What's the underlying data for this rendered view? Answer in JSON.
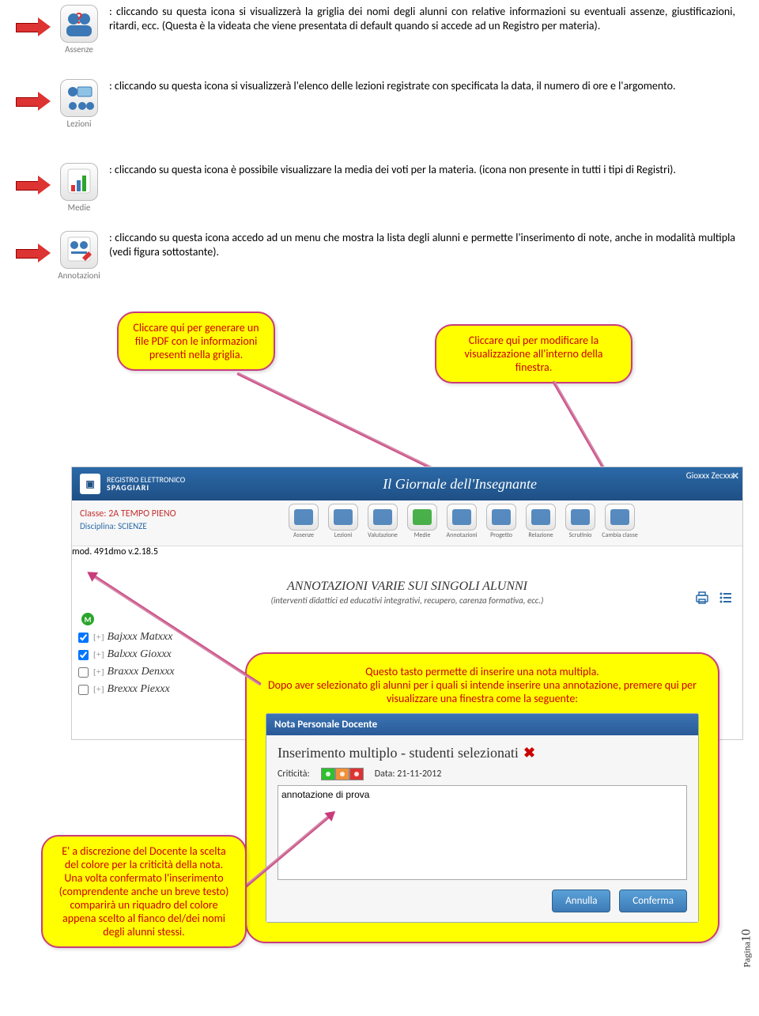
{
  "icons": {
    "assenze": {
      "label": "Assenze",
      "desc": ": cliccando su questa icona si visualizzerà la griglia dei nomi degli alunni con relative informazioni su eventuali assenze, giustificazioni, ritardi, ecc. (Questa è la videata che viene presentata di default quando si accede ad un Registro per materia)."
    },
    "lezioni": {
      "label": "Lezioni",
      "desc": ": cliccando su questa icona si visualizzerà l'elenco delle lezioni registrate con specificata la data, il numero di ore e l'argomento."
    },
    "medie": {
      "label": "Medie",
      "desc": ": cliccando su questa icona è possibile visualizzare la media dei voti per la materia. (icona non presente in tutti i tipi di Registri)."
    },
    "annotaz": {
      "label": "Annotazioni",
      "desc": ": cliccando su questa icona accedo ad un menu che mostra la lista degli alunni e permette l'inserimento di note, anche in modalità multipla (vedi figura sottostante)."
    }
  },
  "callouts": {
    "pdf": "Cliccare qui per generare un file PDF con le informazioni presenti nella griglia.",
    "view": "Cliccare qui per modificare la visualizzazione all'interno della finestra.",
    "multi_intro": "Questo tasto permette di inserire una nota multipla.",
    "multi_more": "Dopo aver selezionato gli alunni per i quali si intende inserire una annotazione, premere qui per visualizzare una finestra come la seguente:",
    "criticita": "E' a discrezione del Docente la scelta del colore per la criticità della nota. Una volta confermato l'inserimento (comprendente anche un breve testo) comparirà un riquadro del colore appena scelto al fianco del/dei nomi degli alunni stessi."
  },
  "screenshot": {
    "brand1": "REGISTRO ELETTRONICO",
    "brand2": "SPAGGIARI",
    "title": "Il Giornale dell'Insegnante",
    "user": "Gioxxx Zecxxx",
    "classe_label": "Classe:",
    "classe": "2A TEMPO PIENO",
    "disc_label": "Disciplina:",
    "disc": "SCIENZE",
    "mod": "mod. 491dmo v.2.18.5",
    "nav": [
      "Assenze",
      "Lezioni",
      "Valutazione",
      "Medie",
      "Annotazioni",
      "Progetto",
      "Relazione",
      "Scrutinio",
      "Cambia classe"
    ],
    "ann_title": "ANNOTAZIONI VARIE SUI SINGOLI ALUNNI",
    "ann_sub": "(interventi didattici ed educativi integrativi, recupero, carenza formativa, ecc.)",
    "m_badge": "M",
    "students": [
      {
        "checked": true,
        "name": "Bajxxx Matxxx"
      },
      {
        "checked": true,
        "name": "Balxxx Gioxxx"
      },
      {
        "checked": false,
        "name": "Braxxx Denxxx"
      },
      {
        "checked": false,
        "name": "Brexxx Piexxx"
      }
    ]
  },
  "dialog": {
    "header": "Nota Personale Docente",
    "title": "Inserimento multiplo - studenti selezionati",
    "crit_label": "Criticità:",
    "data_label": "Data:",
    "data_value": "21-11-2012",
    "text": "annotazione di prova",
    "btn_cancel": "Annulla",
    "btn_ok": "Conferma"
  },
  "page": {
    "label": "Pagina",
    "num": "10"
  }
}
